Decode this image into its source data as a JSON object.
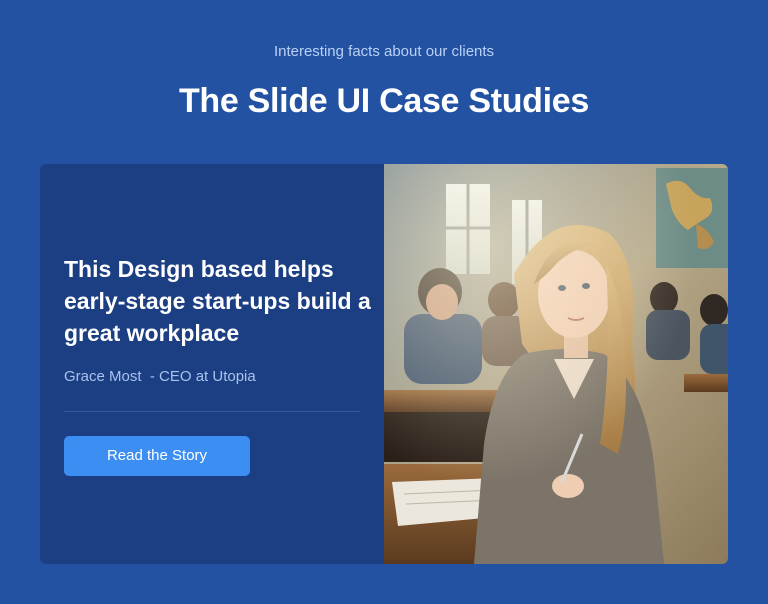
{
  "header": {
    "eyebrow": "Interesting facts about our clients",
    "title": "The Slide UI Case Studies"
  },
  "card": {
    "quote": "This Design based helps early-stage start-ups build a great workplace",
    "author": "Grace Most  - CEO at Utopia",
    "cta_label": "Read the Story",
    "image_subject": "classroom-photo"
  },
  "colors": {
    "background": "#2352a3",
    "card": "#1b3f82",
    "accent": "#3d8ef2"
  }
}
